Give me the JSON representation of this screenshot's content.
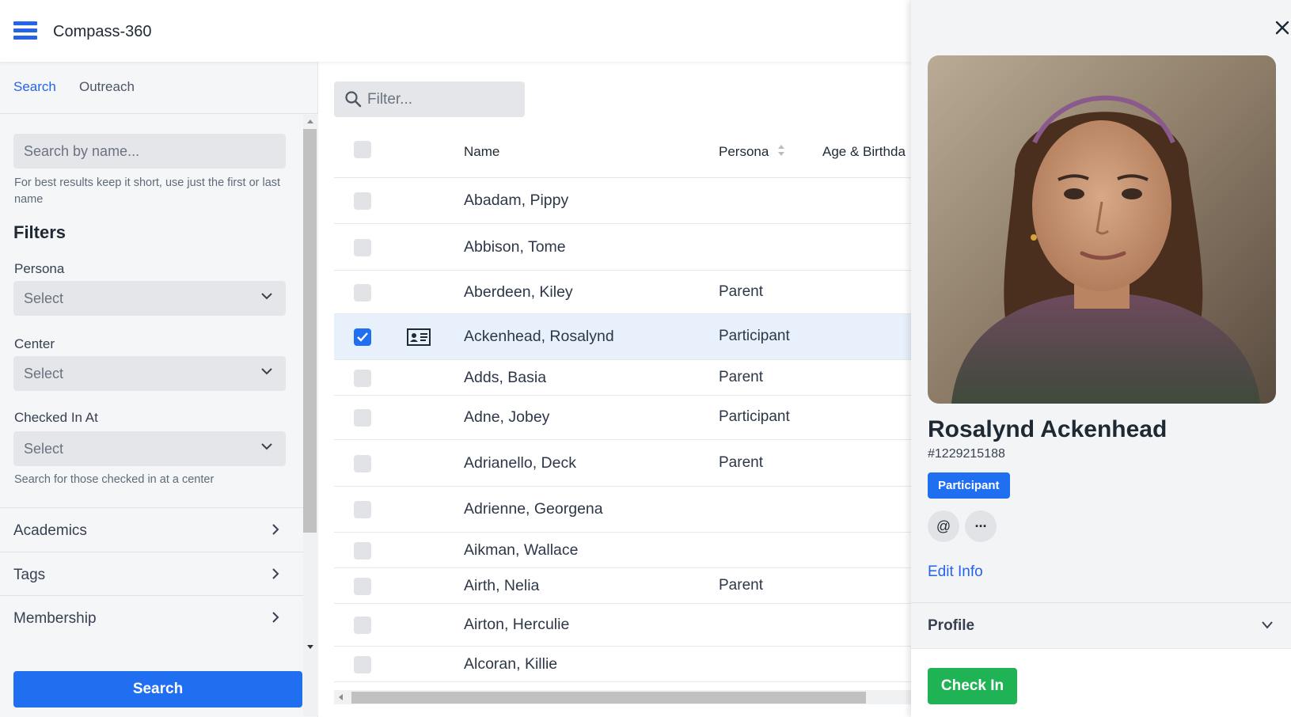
{
  "app": {
    "title": "Compass-360",
    "menu_icon": "hamburger-menu-icon"
  },
  "left_panel": {
    "tabs": [
      {
        "label": "Search",
        "active": true
      },
      {
        "label": "Outreach",
        "active": false
      }
    ],
    "name_search": {
      "placeholder": "Search by name...",
      "hint": "For best results keep it short, use just the first or last name"
    },
    "filters_title": "Filters",
    "filters": [
      {
        "label": "Persona",
        "value": "Select"
      },
      {
        "label": "Center",
        "value": "Select"
      },
      {
        "label": "Checked In At",
        "value": "Select",
        "hint": "Search for those checked in at a center"
      }
    ],
    "sections": [
      "Academics",
      "Tags",
      "Membership"
    ],
    "search_button": "Search"
  },
  "table": {
    "filter_placeholder": "Filter...",
    "columns": [
      "Name",
      "Persona",
      "Age & Birthda"
    ],
    "rows": [
      {
        "name": "Abadam, Pippy",
        "persona": "",
        "checked": false,
        "card": false
      },
      {
        "name": "Abbison, Tome",
        "persona": "",
        "checked": false,
        "card": false
      },
      {
        "name": "Aberdeen, Kiley",
        "persona": "Parent",
        "checked": false,
        "card": false
      },
      {
        "name": "Ackenhead, Rosalynd",
        "persona": "Participant",
        "checked": true,
        "card": true
      },
      {
        "name": "Adds, Basia",
        "persona": "Parent",
        "checked": false,
        "card": false
      },
      {
        "name": "Adne, Jobey",
        "persona": "Participant",
        "checked": false,
        "card": false
      },
      {
        "name": "Adrianello, Deck",
        "persona": "Parent",
        "checked": false,
        "card": false
      },
      {
        "name": "Adrienne, Georgena",
        "persona": "",
        "checked": false,
        "card": false
      },
      {
        "name": "Aikman, Wallace",
        "persona": "",
        "checked": false,
        "card": false
      },
      {
        "name": "Airth, Nelia",
        "persona": "Parent",
        "checked": false,
        "card": false
      },
      {
        "name": "Airton, Herculie",
        "persona": "",
        "checked": false,
        "card": false
      },
      {
        "name": "Alcoran, Killie",
        "persona": "",
        "checked": false,
        "card": false
      }
    ]
  },
  "detail": {
    "name": "Rosalynd Ackenhead",
    "id": "#1229215188",
    "badge": "Participant",
    "actions": [
      {
        "icon": "at-sign-icon",
        "glyph": "@"
      },
      {
        "icon": "more-options-icon",
        "glyph": "···"
      }
    ],
    "edit_link": "Edit Info",
    "profile_section": "Profile",
    "checkin_button": "Check In"
  },
  "colors": {
    "accent": "#1f6ff0",
    "success": "#1fb355",
    "selected_row": "#e8f0fc",
    "panel_bg": "#f5f6f8"
  }
}
